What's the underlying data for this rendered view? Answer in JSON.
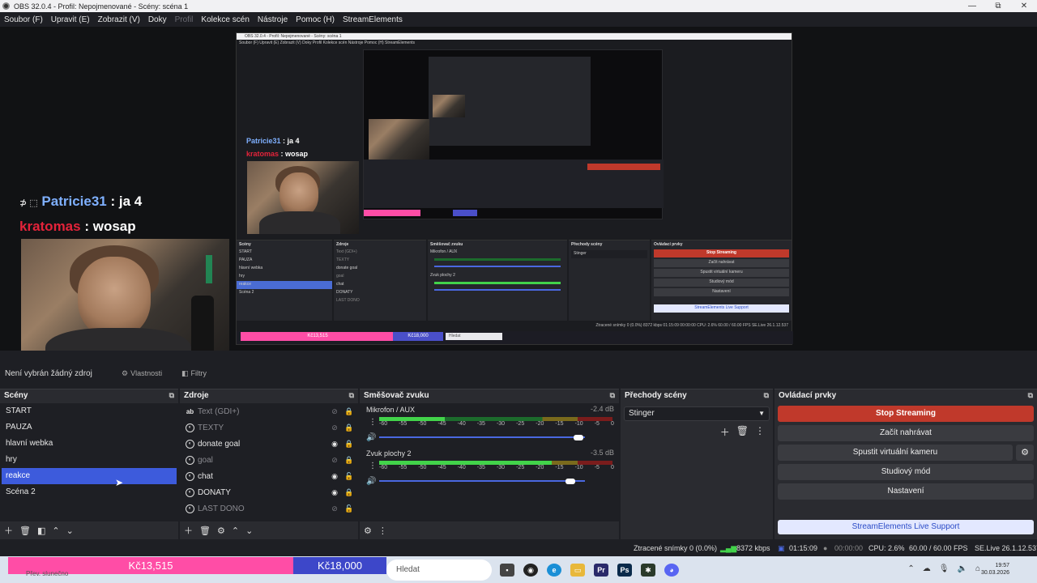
{
  "window": {
    "title": "OBS 32.0.4 - Profil: Nepojmenované - Scény: scéna 1",
    "minimize": "—",
    "maximize": "⧉",
    "close": "✕"
  },
  "menu": [
    {
      "label": "Soubor (F)",
      "disabled": false
    },
    {
      "label": "Upravit (E)",
      "disabled": false
    },
    {
      "label": "Zobrazit (V)",
      "disabled": false
    },
    {
      "label": "Doky",
      "disabled": false
    },
    {
      "label": "Profil",
      "disabled": true
    },
    {
      "label": "Kolekce scén",
      "disabled": false
    },
    {
      "label": "Nástroje",
      "disabled": false
    },
    {
      "label": "Pomoc (H)",
      "disabled": false
    },
    {
      "label": "StreamElements",
      "disabled": false
    }
  ],
  "preview": {
    "chat": [
      {
        "user": "Patricie31",
        "sep": " : ",
        "message": "ja 4",
        "icon": "⊅ ⬚"
      },
      {
        "user": "kratomas",
        "sep": " : ",
        "message": "wosap"
      }
    ],
    "nested": {
      "title": "OBS 32.0.4 - Profil: Nepojmenované - Scény: scéna 1",
      "menu": "Soubor (F)   Upravit (E)   Zobrazit (V)   Doky   Profil   Kolekce scén   Nástroje   Pomoc (H)   StreamElements",
      "scenes_header": "Scény",
      "sources_header": "Zdroje",
      "mixer_header": "Směšovač zvuku",
      "transitions_header": "Přechody scény",
      "controls_header": "Ovládací prvky",
      "status": "Ztracené snímky 0 (0.0%)   8372 kbps   01:15:09   00:00:00   CPU: 2.6%   60.00 / 60.00 FPS   SE.Live 26.1.12.537",
      "pink": "Kč13,515",
      "blue": "Kč18,000",
      "search": "Hledat"
    }
  },
  "below_preview": {
    "no_source": "Není vybrán žádný zdroj",
    "properties": "Vlastnosti",
    "filters": "Filtry"
  },
  "docks": {
    "scenes": {
      "title": "Scény",
      "items": [
        "START",
        "PAUZA",
        "hlavní webka",
        "hry",
        "reakce",
        "Scéna 2"
      ],
      "selected": 4
    },
    "sources": {
      "title": "Zdroje",
      "items": [
        {
          "name": "Text (GDI+)",
          "type": "text",
          "visible": false,
          "locked": true
        },
        {
          "name": "TEXTY",
          "type": "group",
          "visible": false,
          "locked": true
        },
        {
          "name": "donate goal",
          "type": "browser",
          "visible": true,
          "locked": true
        },
        {
          "name": "goal",
          "type": "browser",
          "visible": false,
          "locked": true
        },
        {
          "name": "chat",
          "type": "browser",
          "visible": true,
          "locked": false
        },
        {
          "name": "DONATY",
          "type": "browser",
          "visible": true,
          "locked": true
        },
        {
          "name": "LAST DONO",
          "type": "browser",
          "visible": false,
          "locked": false
        }
      ]
    },
    "mixer": {
      "title": "Směšovač zvuku",
      "scale": [
        "-60",
        "-55",
        "-50",
        "-45",
        "-40",
        "-35",
        "-30",
        "-25",
        "-20",
        "-15",
        "-10",
        "-5",
        "0"
      ],
      "channels": [
        {
          "name": "Mikrofon / AUX",
          "db": "-2.4 dB",
          "level": 0.28,
          "volume": 0.97
        },
        {
          "name": "Zvuk plochy 2",
          "db": "-3.5 dB",
          "level": 0.74,
          "volume": 0.93
        }
      ]
    },
    "transitions": {
      "title": "Přechody scény",
      "selected": "Stinger"
    },
    "controls": {
      "title": "Ovládací prvky",
      "stop_streaming": "Stop Streaming",
      "start_recording": "Začít nahrávat",
      "virtual_camera": "Spustit virtuální kameru",
      "studio_mode": "Studiový mód",
      "settings": "Nastavení",
      "se_support": "StreamElements Live Support"
    }
  },
  "status": {
    "dropped": "Ztracené snímky 0 (0.0%)",
    "kbps": "8372 kbps",
    "stream_time": "01:15:09",
    "rec_time": "00:00:00",
    "cpu": "CPU: 2.6%",
    "fps": "60.00 / 60.00 FPS",
    "se_version": "SE.Live 26.1.12.537"
  },
  "taskbar": {
    "pink_amount": "Kč13,515",
    "blue_amount": "Kč18,000",
    "search": "Hledat",
    "weather": "Přev. slunečno",
    "time": "19:57",
    "date": "30.03.2026"
  },
  "colors": {
    "accent_selected": "#3d5bdc",
    "stop_streaming": "#c0392b",
    "pink_goal": "#ff4da6",
    "blue_goal": "#3d47c9",
    "chat_user1": "#7fb0ff",
    "chat_user2": "#e4233a"
  }
}
